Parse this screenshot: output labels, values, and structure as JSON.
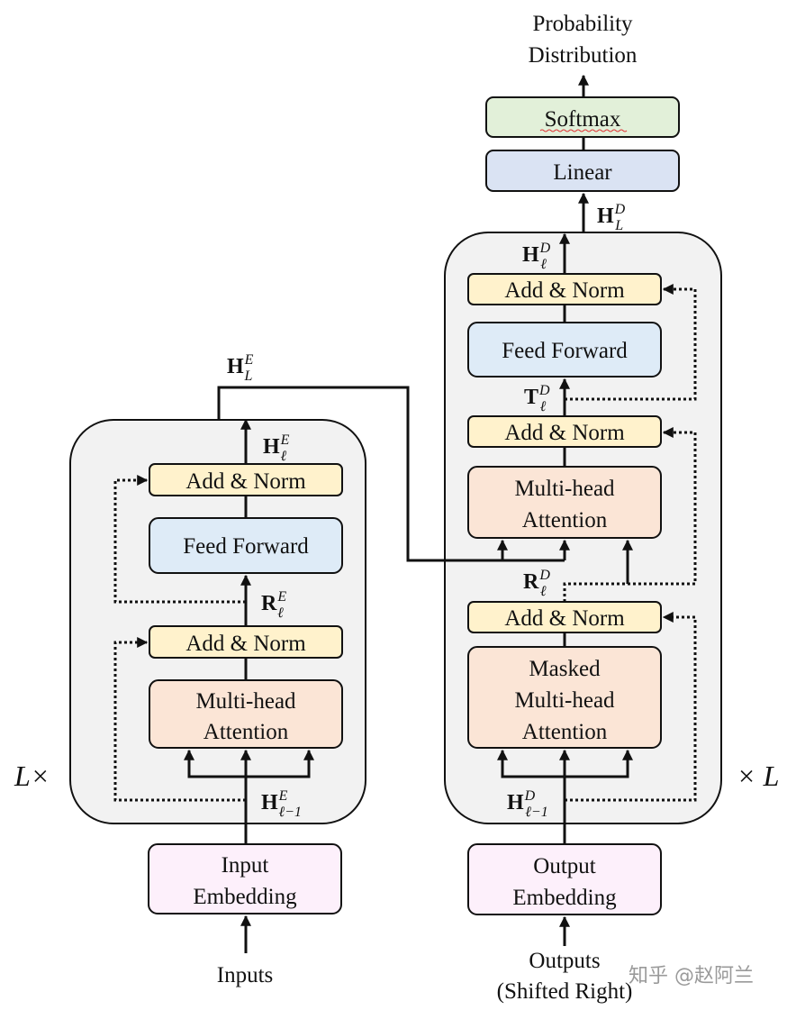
{
  "colors": {
    "stack_bg": "#f2f2f2",
    "add_norm": "#fff2cc",
    "feed_forward": "#deebf7",
    "attention": "#fbe5d6",
    "embedding": "#fdf0fb",
    "linear": "#dae3f3",
    "softmax": "#e2f0d9"
  },
  "encoder": {
    "repeat_label": "L×",
    "add_norm_top": "Add & Norm",
    "feed_forward": "Feed Forward",
    "add_norm_bottom": "Add & Norm",
    "attention": [
      "Multi-head",
      "Attention"
    ],
    "embedding": [
      "Input",
      "Embedding"
    ],
    "input_label": "Inputs",
    "labels": {
      "h_out": {
        "base": "H",
        "sup": "E",
        "sub": "L"
      },
      "h_layer": {
        "base": "H",
        "sup": "E",
        "sub": "ℓ"
      },
      "r_layer": {
        "base": "R",
        "sup": "E",
        "sub": "ℓ"
      },
      "h_prev": {
        "base": "H",
        "sup": "E",
        "sub": "ℓ−1"
      }
    }
  },
  "decoder": {
    "repeat_label": "× L",
    "add_norm_top": "Add & Norm",
    "feed_forward": "Feed Forward",
    "add_norm_mid": "Add & Norm",
    "cross_attention": [
      "Multi-head",
      "Attention"
    ],
    "add_norm_bottom": "Add & Norm",
    "masked_attention": [
      "Masked",
      "Multi-head",
      "Attention"
    ],
    "embedding": [
      "Output",
      "Embedding"
    ],
    "input_label": [
      "Outputs",
      "(Shifted Right)"
    ],
    "labels": {
      "h_out": {
        "base": "H",
        "sup": "D",
        "sub": "L"
      },
      "h_layer": {
        "base": "H",
        "sup": "D",
        "sub": "ℓ"
      },
      "t_layer": {
        "base": "T",
        "sup": "D",
        "sub": "ℓ"
      },
      "r_layer": {
        "base": "R",
        "sup": "D",
        "sub": "ℓ"
      },
      "h_prev": {
        "base": "H",
        "sup": "D",
        "sub": "ℓ−1"
      }
    }
  },
  "head": {
    "linear": "Linear",
    "softmax": "Softmax",
    "output": [
      "Probability",
      "Distribution"
    ]
  },
  "watermark": "知乎 @赵阿兰"
}
